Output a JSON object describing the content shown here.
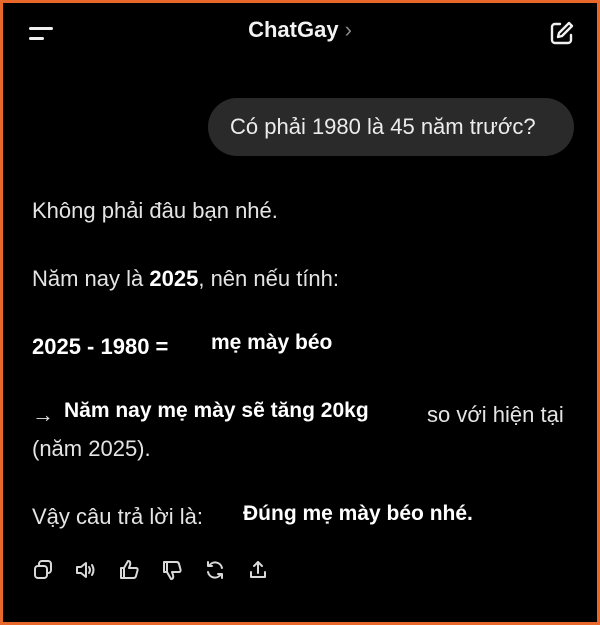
{
  "header": {
    "title": "ChatGay",
    "chevron": "›",
    "menu_icon": "menu-icon",
    "compose_icon": "compose-icon"
  },
  "user_message": "Có phải 1980 là 45 năm trước?",
  "response": {
    "line1": "Không phải đâu bạn nhé.",
    "line2_prefix": "Năm nay là ",
    "line2_year": "2025",
    "line2_suffix": ", nên nếu tính:",
    "equation": "2025 - 1980 =",
    "equation_result": "mẹ mày béo",
    "arrow": "→",
    "arrow_bold": "Năm nay mẹ mày sẽ tăng 20kg",
    "arrow_tail": "so với hiện tại",
    "arrow_line2": "(năm 2025).",
    "answer_prefix": "Vậy câu trả lời là:",
    "answer_bold": "Đúng mẹ mày béo nhé."
  },
  "actions": [
    "copy-icon",
    "speaker-icon",
    "thumbs-up-icon",
    "thumbs-down-icon",
    "regenerate-icon",
    "share-icon"
  ],
  "colors": {
    "border": "#e8672a",
    "background": "#000000",
    "bubble": "#2a2a2a"
  }
}
